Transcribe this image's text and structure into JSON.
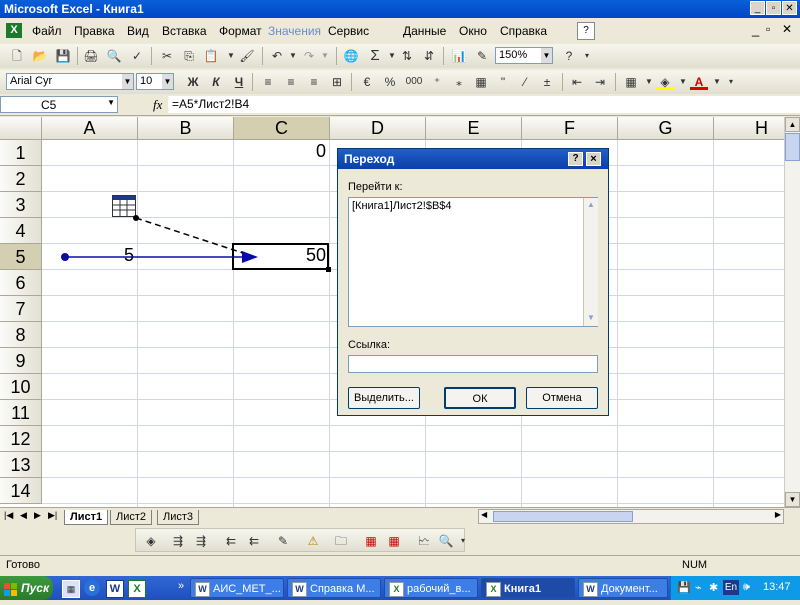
{
  "window": {
    "title": "Microsoft Excel - Книга1"
  },
  "menu": [
    "Файл",
    "Правка",
    "Вид",
    "Вставка",
    "Формат",
    "Значения",
    "Сервис",
    "Данные",
    "Окно",
    "Справка"
  ],
  "toolbar": {
    "zoom": "150%"
  },
  "format_toolbar": {
    "font": "Arial Cyr",
    "size": "10",
    "bold": "Ж",
    "italic": "К",
    "underline": "Ч",
    "currency": "%",
    "thousands": "000"
  },
  "name_box": "C5",
  "formula": "=A5*Лист2!B4",
  "fx": "fx",
  "columns": [
    "A",
    "B",
    "C",
    "D",
    "E",
    "F",
    "G",
    "H"
  ],
  "rows": [
    "1",
    "2",
    "3",
    "4",
    "5",
    "6",
    "7",
    "8",
    "9",
    "10",
    "11",
    "12",
    "13",
    "14"
  ],
  "cells": {
    "C1": "0",
    "A5": "5",
    "C5": "50"
  },
  "sheets": [
    "Лист1",
    "Лист2",
    "Лист3"
  ],
  "dialog": {
    "title": "Переход",
    "goto_label": "Перейти к:",
    "list_item": "[Книга1]Лист2!$B$4",
    "ref_label": "Ссылка:",
    "ref_value": "",
    "special_button": "Выделить...",
    "ok_button": "ОК",
    "cancel_button": "Отмена",
    "help_glyph": "?",
    "close_glyph": "×"
  },
  "status": {
    "left": "Готово",
    "num": "NUM"
  },
  "taskbar": {
    "start": "Пуск",
    "tasks": [
      "АИС_МЕТ_...",
      "Справка М...",
      "рабочий_в...",
      "Книга1",
      "Документ..."
    ],
    "tray_lang": "En",
    "clock": "13:47"
  },
  "colors": {
    "title": "#0a5fd8",
    "arrow": "#0a0aa8",
    "taskbar": "#245edb"
  }
}
